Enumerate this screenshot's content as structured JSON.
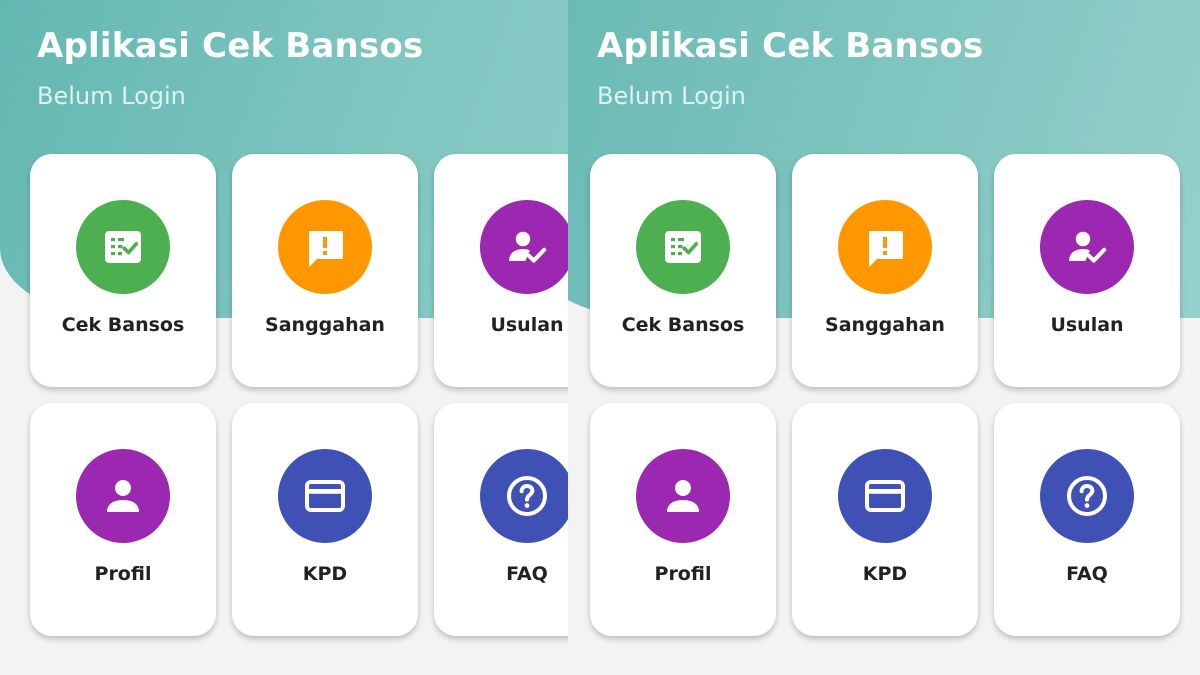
{
  "app": {
    "title": "Aplikasi Cek Bansos",
    "status": "Belum Login"
  },
  "menu": [
    {
      "label": "Cek Bansos",
      "icon": "checklist-icon",
      "color": "#4caf50"
    },
    {
      "label": "Sanggahan",
      "icon": "feedback-alert-icon",
      "color": "#ff9800"
    },
    {
      "label": "Usulan",
      "icon": "person-check-icon",
      "color": "#9c27b0"
    },
    {
      "label": "Profil",
      "icon": "person-icon",
      "color": "#9c27b0"
    },
    {
      "label": "KPD",
      "icon": "credit-card-icon",
      "color": "#3f51b5"
    },
    {
      "label": "FAQ",
      "icon": "help-icon",
      "color": "#3f51b5"
    }
  ],
  "colors": {
    "header": "#6cbcb7",
    "background": "#f3f3f3",
    "card": "#ffffff",
    "label": "#222222"
  }
}
